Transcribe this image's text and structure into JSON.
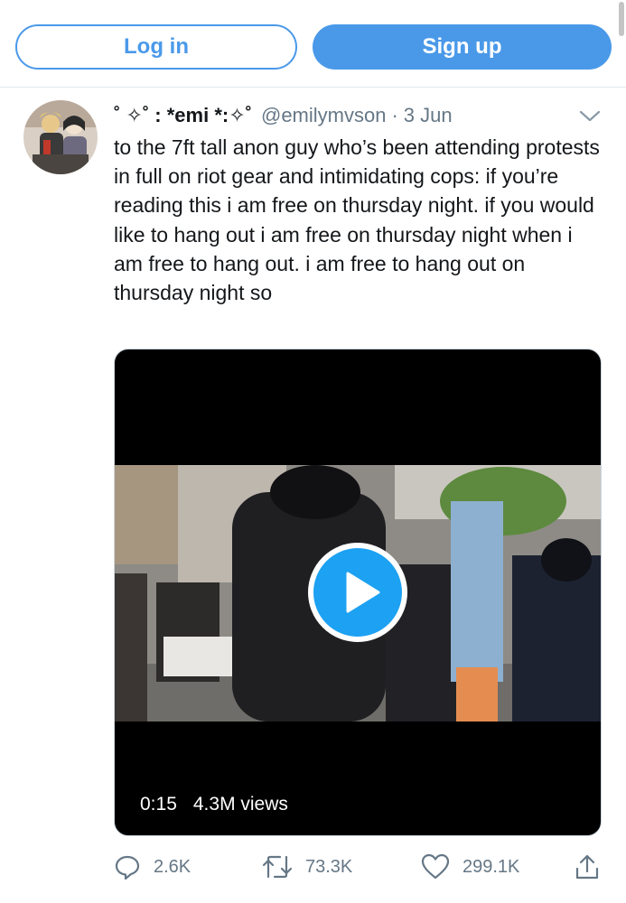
{
  "auth": {
    "login_label": "Log in",
    "signup_label": "Sign up"
  },
  "tweet": {
    "display_name": "˚ ✧˚ : *emi *:✧˚",
    "handle": "@emilymvson",
    "separator": "·",
    "date": "3 Jun",
    "text": "to the 7ft tall anon guy who’s been attending protests in full on riot gear and intimidating cops: if you’re reading this i am free on thursday night. if you would like to hang out i am free on thursday night when i am free to hang out. i am free to hang out on thursday night so",
    "video": {
      "duration": "0:15",
      "views": "4.3M views"
    },
    "stats": {
      "replies": "2.6K",
      "retweets": "73.3K",
      "likes": "299.1K"
    }
  },
  "icons": {
    "more": "chevron-down-icon",
    "reply": "reply-icon",
    "retweet": "retweet-icon",
    "like": "heart-icon",
    "share": "share-icon",
    "play": "play-icon"
  },
  "colors": {
    "accent": "#4a99e9",
    "secondary_text": "#657786",
    "primary_text": "#14171a"
  }
}
